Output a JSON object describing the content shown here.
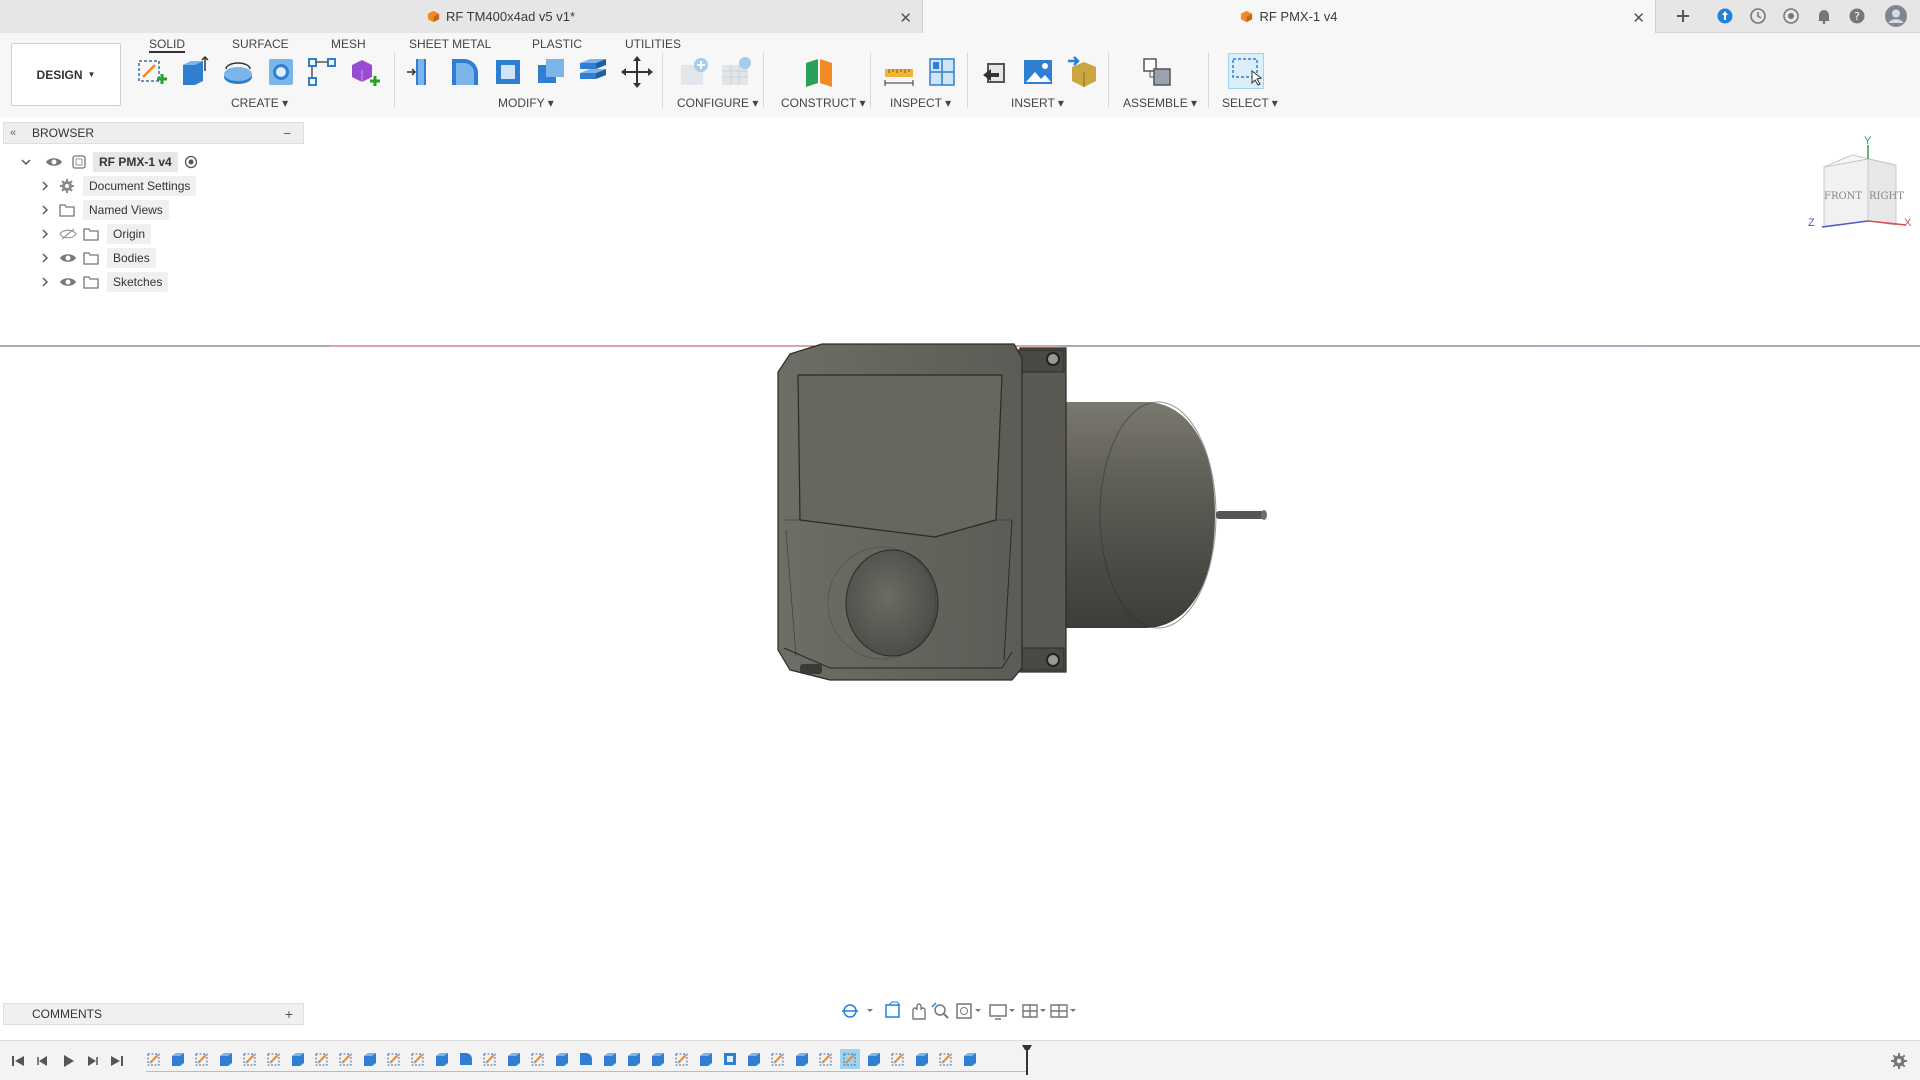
{
  "tabs": [
    {
      "label": "RF TM400x4ad v5 v1*",
      "active": false
    },
    {
      "label": "RF PMX-1 v4",
      "active": true
    }
  ],
  "toolbar": {
    "workspace_label": "DESIGN",
    "workspace_tabs": [
      "SOLID",
      "SURFACE",
      "MESH",
      "SHEET METAL",
      "PLASTIC",
      "UTILITIES"
    ],
    "active_workspace_tab": "SOLID",
    "groups": {
      "create": "CREATE",
      "modify": "MODIFY",
      "configure": "CONFIGURE",
      "construct": "CONSTRUCT",
      "inspect": "INSPECT",
      "insert": "INSERT",
      "assemble": "ASSEMBLE",
      "select": "SELECT"
    }
  },
  "browser": {
    "title": "BROWSER",
    "root": "RF PMX-1 v4",
    "items": [
      {
        "label": "Document Settings",
        "icon": "gear-icon"
      },
      {
        "label": "Named Views",
        "icon": "folder-icon"
      },
      {
        "label": "Origin",
        "icon": "folder-icon",
        "visibility": "hidden-eye-icon"
      },
      {
        "label": "Bodies",
        "icon": "folder-icon",
        "visibility": "eye-icon"
      },
      {
        "label": "Sketches",
        "icon": "folder-icon",
        "visibility": "eye-icon"
      }
    ]
  },
  "viewcube": {
    "front": "FRONT",
    "right": "RIGHT",
    "axis_y": "Y",
    "axis_z": "Z",
    "axis_x": "X"
  },
  "comments": {
    "title": "COMMENTS"
  },
  "colors": {
    "accent": "#0696d7",
    "model": "#5f5e59",
    "axis_red": "#d35050",
    "selected": "#9fd3ef"
  }
}
